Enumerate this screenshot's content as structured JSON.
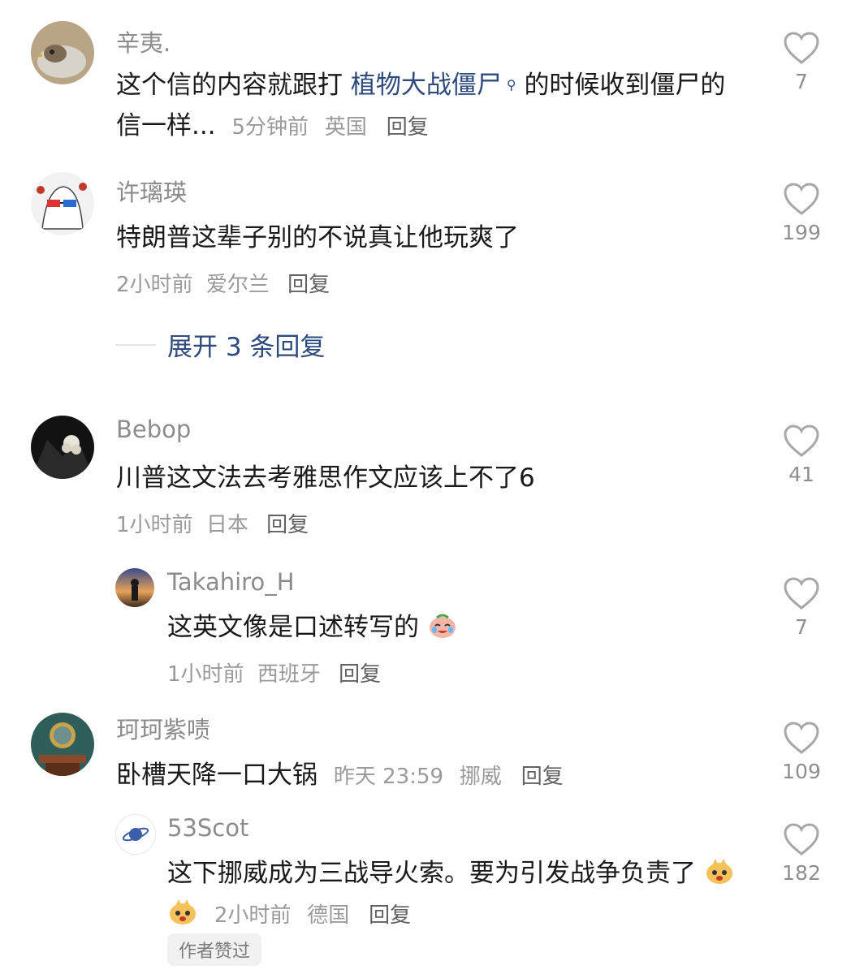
{
  "comments": [
    {
      "username": "辛夷.",
      "text_before": "这个信的内容就跟打",
      "link_text": "植物大战僵尸",
      "text_after": "的时候收到僵尸的信一样...",
      "time": "5分钟前",
      "location": "英国",
      "reply": "回复",
      "likes": "7"
    },
    {
      "username": "许璃瑛",
      "text": "特朗普这辈子别的不说真让他玩爽了",
      "time": "2小时前",
      "location": "爱尔兰",
      "reply": "回复",
      "likes": "199",
      "expand_replies": "展开 3 条回复"
    },
    {
      "username": "Bebop",
      "text": "川普这文法去考雅思作文应该上不了6",
      "time": "1小时前",
      "location": "日本",
      "reply": "回复",
      "likes": "41"
    },
    {
      "username": "Takahiro_H",
      "text": "这英文像是口述转写的",
      "emoji": "crying-laughing-emoji",
      "time": "1小时前",
      "location": "西班牙",
      "reply": "回复",
      "likes": "7"
    },
    {
      "username": "珂珂紫啧",
      "text": "卧槽天降一口大锅",
      "time": "昨天 23:59",
      "location": "挪威",
      "reply": "回复",
      "likes": "109"
    },
    {
      "username": "53Scot",
      "text": "这下挪威成为三战导火索。要为引发战争负责了",
      "emoji": "cat-face-emoji",
      "time": "2小时前",
      "location": "德国",
      "reply": "回复",
      "likes": "182",
      "badge": "作者赞过"
    }
  ],
  "colors": {
    "link": "#2e4a7d",
    "meta": "#9a9a9a",
    "username": "#8c8c8c"
  }
}
